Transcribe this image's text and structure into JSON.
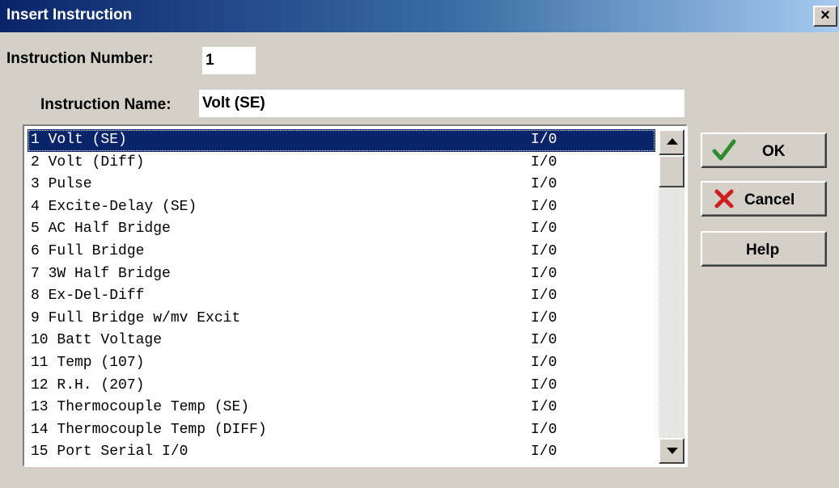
{
  "window": {
    "title": "Insert Instruction",
    "close_glyph": "×"
  },
  "form": {
    "instruction_number_label": "Instruction Number:",
    "instruction_number_value": "1",
    "instruction_name_label": "Instruction Name:",
    "instruction_name_value": "Volt (SE)"
  },
  "list": {
    "selected_index": 0,
    "items": [
      {
        "name": "1 Volt (SE)",
        "category": "I/0"
      },
      {
        "name": "2 Volt (Diff)",
        "category": "I/0"
      },
      {
        "name": "3 Pulse",
        "category": "I/0"
      },
      {
        "name": "4 Excite-Delay (SE)",
        "category": "I/0"
      },
      {
        "name": "5 AC Half Bridge",
        "category": "I/0"
      },
      {
        "name": "6 Full Bridge",
        "category": "I/0"
      },
      {
        "name": "7 3W Half Bridge",
        "category": "I/0"
      },
      {
        "name": "8 Ex-Del-Diff",
        "category": "I/0"
      },
      {
        "name": "9 Full Bridge w/mv Excit",
        "category": "I/0"
      },
      {
        "name": "10 Batt Voltage",
        "category": "I/0"
      },
      {
        "name": "11 Temp (107)",
        "category": "I/0"
      },
      {
        "name": "12 R.H. (207)",
        "category": "I/0"
      },
      {
        "name": "13 Thermocouple Temp (SE)",
        "category": "I/0"
      },
      {
        "name": "14 Thermocouple Temp (DIFF)",
        "category": "I/0"
      },
      {
        "name": "15 Port Serial I/0",
        "category": "I/0"
      }
    ]
  },
  "buttons": {
    "ok_label": "OK",
    "cancel_label": "Cancel",
    "help_label": "Help"
  },
  "icons": {
    "ok": "green-checkmark-icon",
    "cancel": "red-x-icon",
    "close": "close-icon",
    "scroll_up": "triangle-up-icon",
    "scroll_down": "triangle-down-icon"
  },
  "colors": {
    "title_start": "#0a246a",
    "title_end": "#a6caf0",
    "selection": "#0a246a",
    "ok_check": "#2e8b2e",
    "cancel_x": "#cc1f1f",
    "dialog_bg": "#d4d0c8"
  }
}
